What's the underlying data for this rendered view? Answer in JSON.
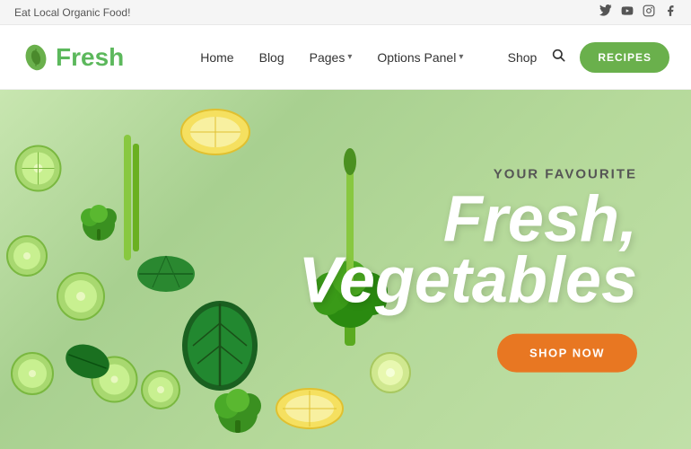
{
  "topbar": {
    "tagline": "Eat Local Organic Food!",
    "socials": [
      "twitter",
      "youtube",
      "instagram",
      "facebook"
    ]
  },
  "header": {
    "logo_text": "Fresh",
    "nav_items": [
      {
        "label": "Home",
        "has_dropdown": false
      },
      {
        "label": "Blog",
        "has_dropdown": false
      },
      {
        "label": "Pages",
        "has_dropdown": true
      },
      {
        "label": "Options Panel",
        "has_dropdown": true
      }
    ],
    "shop_label": "Shop",
    "recipes_label": "RECIPES"
  },
  "hero": {
    "subtitle": "YOUR FAVOURITE",
    "title_line1": "Fresh,",
    "title_line2": "Vegetables",
    "cta_label": "SHOP NOW",
    "bg_color": "#b8d8a8"
  }
}
